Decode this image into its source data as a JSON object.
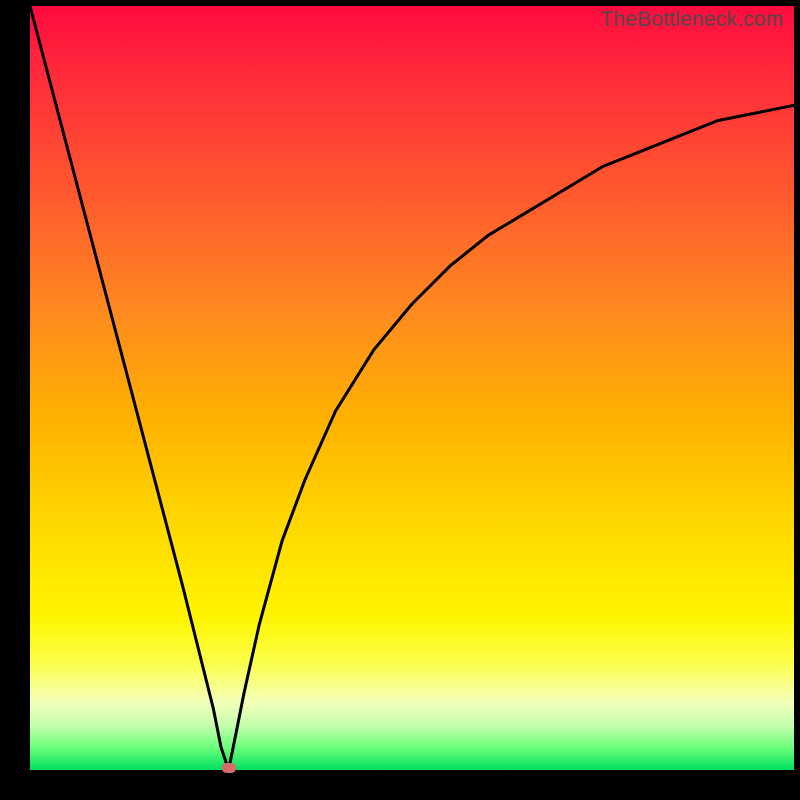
{
  "attribution": "TheBottleneck.com",
  "colors": {
    "gradient_top": "#ff0a3f",
    "gradient_mid1": "#ff8a1f",
    "gradient_mid2": "#ffd800",
    "gradient_bottom": "#00e060",
    "curve": "#000000",
    "marker": "#d66b6b",
    "frame": "#000000"
  },
  "chart_data": {
    "type": "line",
    "title": "",
    "xlabel": "",
    "ylabel": "",
    "xlim": [
      0,
      100
    ],
    "ylim": [
      0,
      100
    ],
    "grid": false,
    "legend": false,
    "annotations": [],
    "marker": {
      "x": 26,
      "y": 0
    },
    "series": [
      {
        "name": "curve",
        "comment": "V-shaped curve: near-linear descending left branch, minimum around x≈26 at y≈0, then logarithmic-like rise on the right branch approaching ~87.",
        "x": [
          0,
          5,
          10,
          15,
          20,
          24,
          25,
          26,
          27,
          28,
          30,
          33,
          36,
          40,
          45,
          50,
          55,
          60,
          65,
          70,
          75,
          80,
          85,
          90,
          95,
          100
        ],
        "values": [
          100,
          81,
          62,
          43,
          24,
          8,
          3,
          0,
          5,
          10,
          19,
          30,
          38,
          47,
          55,
          61,
          66,
          70,
          73,
          76,
          79,
          81,
          83,
          85,
          86,
          87
        ]
      }
    ]
  }
}
